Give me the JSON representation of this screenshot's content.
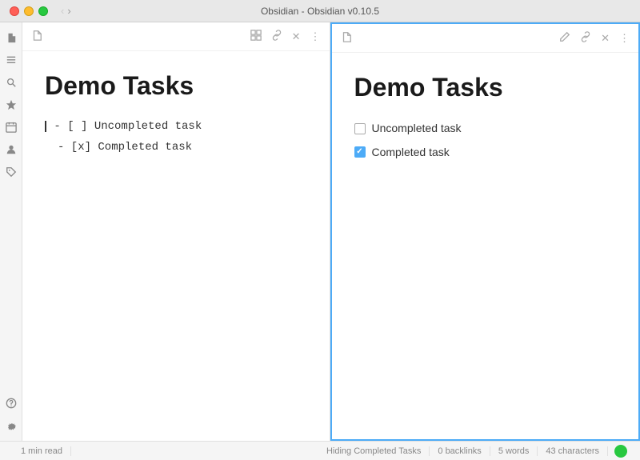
{
  "titleBar": {
    "title": "Obsidian - Obsidian v0.10.5",
    "backLabel": "‹",
    "forwardLabel": "›"
  },
  "sidebar": {
    "icons": [
      {
        "name": "file-icon",
        "symbol": "📄"
      },
      {
        "name": "hamburger-icon",
        "symbol": "≡"
      },
      {
        "name": "search-icon",
        "symbol": "⊕"
      },
      {
        "name": "star-icon",
        "symbol": "✦"
      },
      {
        "name": "calendar-icon",
        "symbol": "◫"
      },
      {
        "name": "person-icon",
        "symbol": "◉"
      },
      {
        "name": "tag-icon",
        "symbol": "⊞"
      },
      {
        "name": "gear-icon",
        "symbol": "⚙"
      },
      {
        "name": "help-icon",
        "symbol": "?"
      },
      {
        "name": "settings-icon",
        "symbol": "⊙"
      }
    ]
  },
  "leftPane": {
    "toolbar": {
      "fileIcon": "📄",
      "gridIcon": "⊞",
      "linkIcon": "🔗",
      "closeIcon": "×",
      "moreIcon": "⋮"
    },
    "title": "Demo Tasks",
    "tasks": [
      {
        "raw": "- [ ] Uncompleted task",
        "type": "uncompleted"
      },
      {
        "raw": "- [x] Completed task",
        "type": "completed"
      }
    ]
  },
  "rightPane": {
    "toolbar": {
      "fileIcon": "📄",
      "editIcon": "✏",
      "linkIcon": "🔗",
      "closeIcon": "×",
      "moreIcon": "⋮"
    },
    "title": "Demo Tasks",
    "tasks": [
      {
        "label": "Uncompleted task",
        "completed": false
      },
      {
        "label": "Completed task",
        "completed": true
      }
    ]
  },
  "statusBar": {
    "readTime": "1 min read",
    "hidingStatus": "Hiding Completed Tasks",
    "backlinks": "0 backlinks",
    "words": "5 words",
    "characters": "43 characters"
  }
}
